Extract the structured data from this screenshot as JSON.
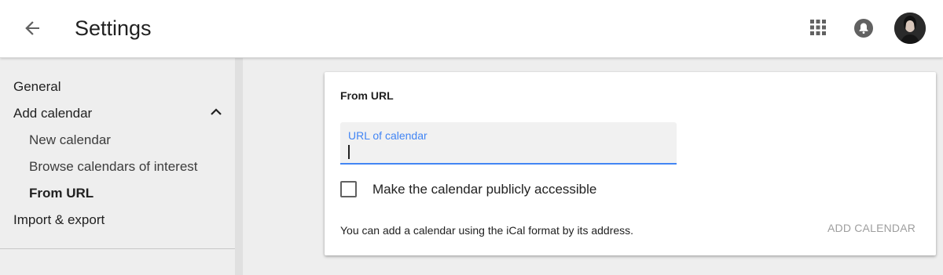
{
  "header": {
    "back_icon": "arrow-back-icon",
    "title": "Settings",
    "apps_icon": "apps-grid-icon",
    "notifications_icon": "notifications-bell-icon",
    "avatar_icon": "user-avatar"
  },
  "sidebar": {
    "items": [
      {
        "label": "General"
      },
      {
        "label": "Add calendar",
        "expanded": true
      },
      {
        "label": "New calendar"
      },
      {
        "label": "Browse calendars of interest"
      },
      {
        "label": "From URL",
        "selected": true
      },
      {
        "label": "Import & export"
      }
    ],
    "chevron_icon": "chevron-up-icon"
  },
  "card": {
    "title": "From URL",
    "url_field": {
      "label": "URL of calendar",
      "value": ""
    },
    "checkbox": {
      "label": "Make the calendar publicly accessible",
      "checked": false
    },
    "help_text": "You can add a calendar using the iCal format by its address.",
    "add_button": "ADD CALENDAR"
  },
  "colors": {
    "accent": "#4285f4",
    "disabled_text": "#9e9e9e",
    "background": "#eeeeee"
  }
}
